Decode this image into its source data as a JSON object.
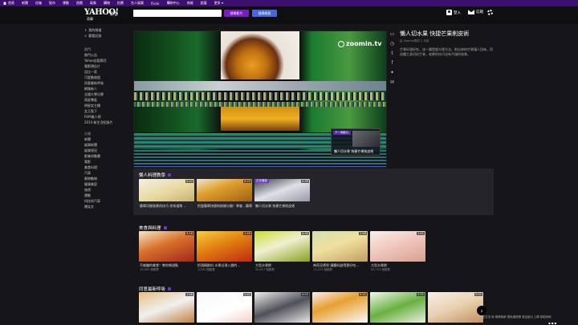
{
  "topnav": [
    "首頁",
    "新聞",
    "信箱",
    "股市",
    "運動",
    "遊戲",
    "氣象",
    "購物",
    "拍賣",
    "名人娛樂",
    "Flickr",
    "購物中心",
    "商城",
    "超值",
    "更多 ▾"
  ],
  "header": {
    "logo": "YAHOO!",
    "logo_sub": "奇摩",
    "logo_tag": "影音",
    "search_placeholder": "",
    "search_video": "搜尋影片",
    "search_web": "搜尋網頁",
    "login": "登入",
    "mail": "信箱"
  },
  "sidebar": {
    "top": [
      {
        "icon": "↥",
        "label": "我的頻道"
      },
      {
        "icon": "⊙",
        "label": "觀看記錄"
      }
    ],
    "sec1_title": "熱門",
    "sec1": [
      "熱門公告",
      "Yahoo自製節目",
      "電影預告片",
      "逗比一家",
      "可愛動物園",
      "同意最新呼吸",
      "網路新人",
      "全國大學比賽",
      "萌星專區",
      "明星女主播",
      "女王陛下",
      "FHM美人榜",
      "2014 新生活紀錄片"
    ],
    "sec2_title": "分類",
    "sec2": [
      "新聞",
      "娛樂新聞",
      "娛樂現況",
      "影集與動畫",
      "電影",
      "美食料理",
      "汽車",
      "寵物動物",
      "健康美容",
      "旅遊",
      "運動",
      "科技與汽車",
      "爆笑文"
    ]
  },
  "player": {
    "brand": "zoomin.tv",
    "upnext_tag": "下一個影片",
    "upnext_title": "懶人切水果 快捷芒果削皮術"
  },
  "video": {
    "title": "懶人切水果 快捷芒果削皮術",
    "meta": "由 Zoomin提供 2 天前",
    "desc": "芒果好甜好吃，這一類是超方便方法，削出來的芒果讓人回味，用這種工具切好芒果，老師的技巧也有不錯的效果。"
  },
  "share_icons": [
    "comment-icon",
    "clock-icon",
    "tumblr-icon",
    "facebook-icon",
    "twitter-icon",
    "mail-icon"
  ],
  "panel1": {
    "title": "懶人料理教學",
    "cards": [
      {
        "dur": "0:43",
        "cap": "簡單切開香蕉的技巧  你知道嗎 …",
        "playing": ""
      },
      {
        "dur": "0:23",
        "cap": "把蛋簡單快捷地剝開分離！學會…簡單…",
        "playing": ""
      },
      {
        "dur": "0:39",
        "cap": "懶人切水果 快捷芒果削皮術",
        "playing": "正在播放"
      }
    ]
  },
  "panel2": {
    "title": "美食與料理",
    "cards": [
      {
        "dur": "4:18",
        "cap": "不被騙的美食！教你做甜點",
        "sub": "10,000 個觀看"
      },
      {
        "dur": "1:49",
        "cap": "把酒精飲料 水果出現入戲的…",
        "sub": "1,000 個觀看"
      },
      {
        "dur": "4:30",
        "cap": "方型水果餅",
        "sub": "20,017 個觀看"
      },
      {
        "dur": "1:46",
        "cap": "神奇沒想到 讓醬料變得更好吃…",
        "sub": "13,223 個觀看"
      },
      {
        "dur": "1:51",
        "cap": "方型水果餅",
        "sub": "63,733 個觀看"
      }
    ]
  },
  "panel3": {
    "title": "同意最新呼吸",
    "cards": [
      {
        "dur": "1:46"
      },
      {
        "dur": "1:41"
      },
      {
        "dur": "4:02"
      },
      {
        "dur": "2:11"
      },
      {
        "dur": "3:31"
      },
      {
        "dur": "5:01"
      }
    ]
  },
  "footer": {
    "links": "意見交流 與 服務條款          隱私權政策     歡迎影片上傳     幫助說明"
  },
  "colors": {
    "purple": "#3d0f6e",
    "accent": "#7a1cbf",
    "web_btn": "#4a66d8"
  }
}
